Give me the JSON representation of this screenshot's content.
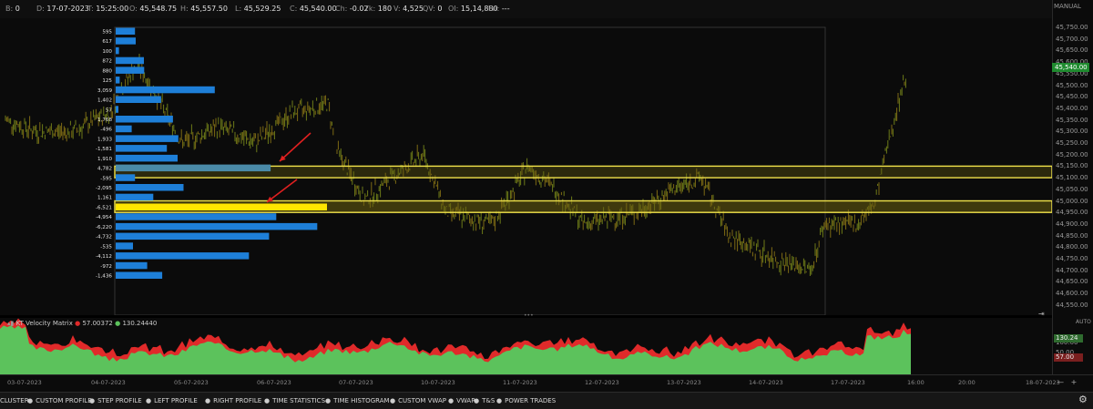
{
  "topbar": {
    "fields": [
      {
        "k": "B:",
        "v": "0"
      },
      {
        "k": "D:",
        "v": "17-07-2023"
      },
      {
        "k": "T:",
        "v": "15:25:00"
      },
      {
        "k": "O:",
        "v": "45,548.75"
      },
      {
        "k": "H:",
        "v": "45,557.50"
      },
      {
        "k": "L:",
        "v": "45,529.25"
      },
      {
        "k": "C:",
        "v": "45,540.00"
      },
      {
        "k": "Ch:",
        "v": "-0.02"
      },
      {
        "k": "Tk:",
        "v": "180"
      },
      {
        "k": "V:",
        "v": "4,525"
      },
      {
        "k": "QV:",
        "v": "0"
      },
      {
        "k": "OI:",
        "v": "15,14,880"
      },
      {
        "k": "Fn:",
        "v": "---"
      }
    ]
  },
  "price_axis": {
    "mode": "MANUAL",
    "labels": [
      "45,750.00",
      "45,700.00",
      "45,650.00",
      "45,600.00",
      "45,550.00",
      "45,500.00",
      "45,450.00",
      "45,400.00",
      "45,350.00",
      "45,300.00",
      "45,250.00",
      "45,200.00",
      "45,150.00",
      "45,100.00",
      "45,050.00",
      "45,000.00",
      "44,950.00",
      "44,900.00",
      "44,850.00",
      "44,800.00",
      "44,750.00",
      "44,700.00",
      "44,650.00",
      "44,600.00",
      "44,550.00"
    ],
    "current_price": "45,540.00"
  },
  "profile": {
    "labels": [
      "595",
      "617",
      "100",
      "872",
      "880",
      "125",
      "3,059",
      "1,402",
      "57",
      "1,768",
      "-496",
      "1,933",
      "-1,581",
      "1,910",
      "4,782",
      "-595",
      "-2,095",
      "1,161",
      "-6,521",
      "-4,954",
      "-6,220",
      "-4,732",
      "-535",
      "-4,112",
      "-972",
      "-1,436"
    ],
    "values": [
      595,
      617,
      100,
      872,
      880,
      125,
      3059,
      1402,
      57,
      1768,
      -496,
      1933,
      -1581,
      1910,
      4782,
      -595,
      -2095,
      1161,
      -6521,
      -4954,
      -6220,
      -4732,
      -535,
      -4112,
      -972,
      -1436
    ]
  },
  "indicator": {
    "title": "KT Velocity Matrix",
    "val_red": "57.00372",
    "val_green": "130.24440",
    "mode": "AUTO",
    "axis_labels": [
      "100.00",
      "50.00"
    ],
    "badge_green": "130.24",
    "badge_red": "57.00"
  },
  "time_axis": {
    "labels": [
      "03-07-2023",
      "04-07-2023",
      "05-07-2023",
      "06-07-2023",
      "07-07-2023",
      "10-07-2023",
      "11-07-2023",
      "12-07-2023",
      "13-07-2023",
      "14-07-2023",
      "17-07-2023",
      "16:00",
      "20:00",
      "18-07-2023"
    ]
  },
  "bottom_tabs": [
    "CLUSTER",
    "CUSTOM PROFILE",
    "STEP PROFILE",
    "LEFT PROFILE",
    "RIGHT PROFILE",
    "TIME STATISTICS",
    "TIME HISTOGRAM",
    "CUSTOM VWAP",
    "VWAP",
    "T&S",
    "POWER TRADES"
  ],
  "colors": {
    "candle": "#8a7a1a",
    "profile_bar": "#1e7fd8",
    "profile_highlight": "#ffe600",
    "zone_border": "#f0e24a",
    "zone_fill": "#6b6110",
    "arrow": "#e02020",
    "ind_green": "#5cc25c",
    "ind_red": "#e02a2a"
  }
}
